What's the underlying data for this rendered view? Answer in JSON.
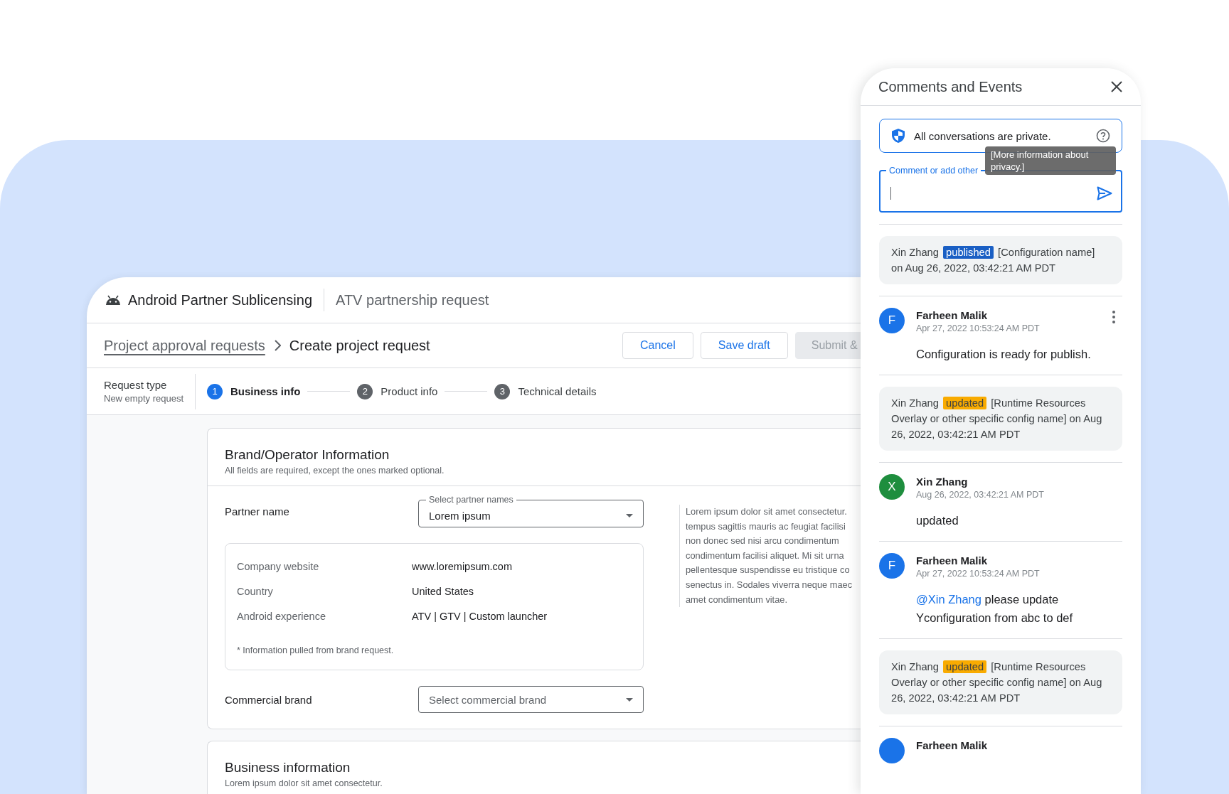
{
  "app": {
    "title": "Android Partner Sublicensing",
    "subtitle": "ATV partnership request"
  },
  "breadcrumb": {
    "parent": "Project approval requests",
    "current": "Create project request"
  },
  "actions": [
    {
      "label": "Cancel",
      "disabled": false
    },
    {
      "label": "Save draft",
      "disabled": false
    },
    {
      "label": "Submit &",
      "disabled": true
    }
  ],
  "request_type": {
    "label": "Request type",
    "value": "New empty request"
  },
  "steps": [
    {
      "number": "1",
      "label": "Business info",
      "selected": true
    },
    {
      "number": "2",
      "label": "Product info",
      "selected": false
    },
    {
      "number": "3",
      "label": "Technical details",
      "selected": false
    }
  ],
  "brand_section": {
    "title": "Brand/Operator Information",
    "subtitle": "All fields are required, except the ones marked optional.",
    "partner_field": {
      "label": "Partner name",
      "floating_label": "Select partner names",
      "value": "Lorem ipsum"
    },
    "info_rows": [
      {
        "label": "Company website",
        "value": "www.loremipsum.com"
      },
      {
        "label": "Country",
        "value": "United States"
      },
      {
        "label": "Android experience",
        "value": "ATV | GTV | Custom launcher"
      }
    ],
    "info_note": "* Information pulled from brand request.",
    "commercial_field": {
      "label": "Commercial brand",
      "placeholder": "Select commercial brand"
    },
    "note_lines": [
      "Lorem ipsum dolor sit amet consectetur.",
      "tempus sagittis mauris ac feugiat facilisi",
      "non donec sed nisi arcu condimentum",
      "condimentum facilisi aliquet. Mi sit urna",
      "pellentesque suspendisse eu tristique co",
      "senectus in. Sodales viverra neque maec",
      "amet condimentum vitae."
    ]
  },
  "business_section": {
    "title": "Business information",
    "subtitle": "Lorem ipsum dolor sit amet consectetur."
  },
  "comments_panel": {
    "title": "Comments and Events",
    "privacy": {
      "text": "All conversations are private.",
      "tooltip": "[More information about privacy.]"
    },
    "comment_field": {
      "label": "Comment or add other"
    },
    "items": [
      {
        "kind": "event",
        "actor": "Xin Zhang",
        "action": "published",
        "color": "#1a5fc4",
        "description": "[Configuration name] on Aug 26, 2022, 03:42:21 AM PDT"
      },
      {
        "kind": "comment",
        "avatar": "F",
        "color": "#1a73e8",
        "name": "Farheen Malik",
        "time": "Apr 27, 2022 10:53:24 AM PDT",
        "text": "Configuration is ready for publish.",
        "has_menu": true
      },
      {
        "kind": "event",
        "actor": "Xin Zhang",
        "action": "updated",
        "color": "#f9ab00",
        "description": "[Runtime Resources Overlay or other specific config name] on Aug 26, 2022, 03:42:21 AM PDT"
      },
      {
        "kind": "comment",
        "avatar": "X",
        "color": "#1e8e3e",
        "name": "Xin Zhang",
        "time": "Aug 26, 2022, 03:42:21 AM PDT",
        "text": "updated",
        "has_menu": false
      },
      {
        "kind": "comment",
        "avatar": "F",
        "color": "#1a73e8",
        "name": "Farheen Malik",
        "time": "Apr 27, 2022 10:53:24 AM PDT",
        "mention": "@Xin Zhang",
        "text": "please update Yconfiguration from abc to def",
        "has_menu": false
      },
      {
        "kind": "event",
        "actor": "Xin Zhang",
        "action": "updated",
        "color": "#f9ab00",
        "description": "[Runtime Resources Overlay or other specific config name] on Aug 26, 2022, 03:42:21 AM PDT"
      },
      {
        "kind": "comment",
        "color": "#1a73e8",
        "name": "Farheen Malik"
      }
    ]
  }
}
